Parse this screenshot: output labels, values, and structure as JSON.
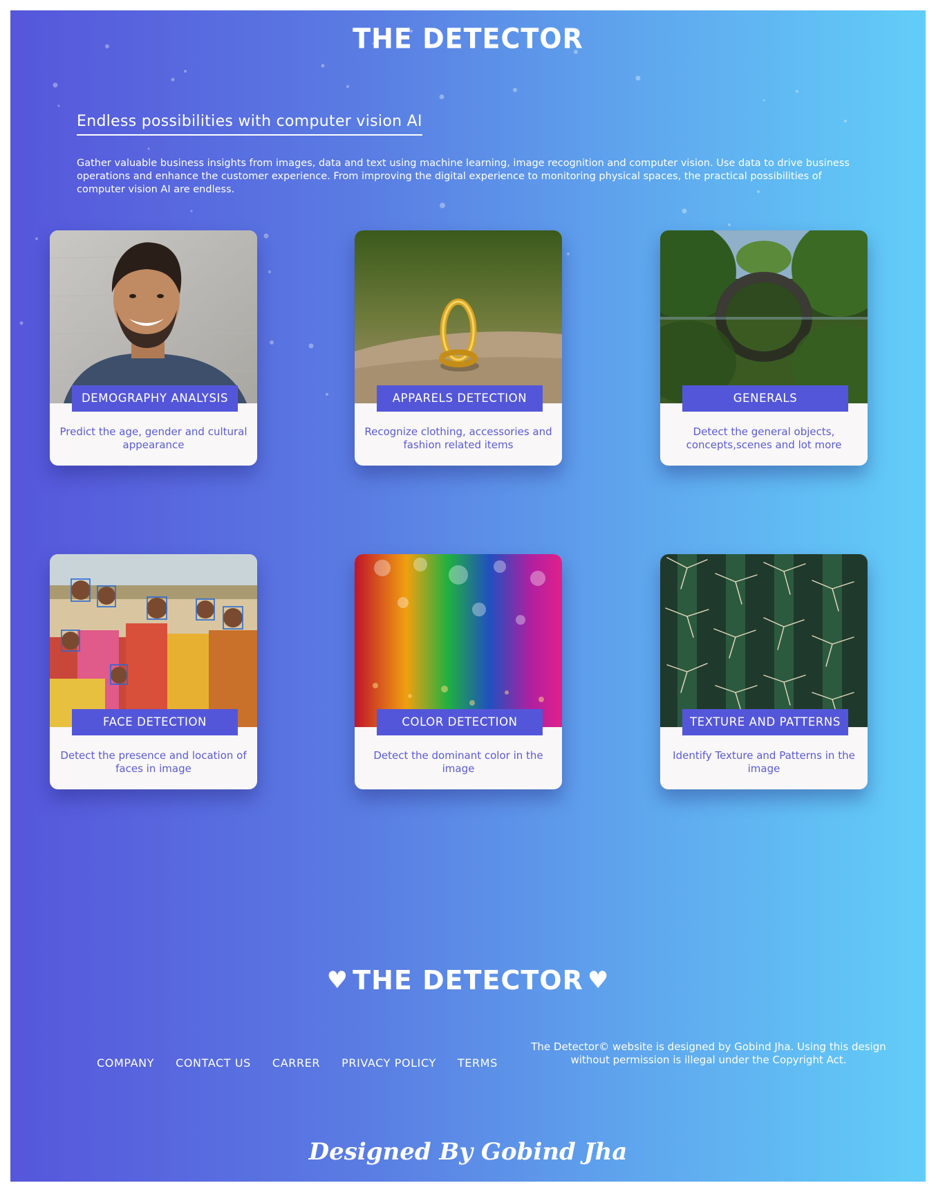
{
  "header": {
    "logo": "THE DETECTOR"
  },
  "hero": {
    "headline": "Endless possibilities with computer vision AI",
    "intro": "Gather valuable business insights from images, data and text using machine learning, image recognition and computer vision. Use data to drive business operations and enhance the customer experience. From improving the digital experience to monitoring physical spaces, the practical possibilities of computer vision AI are endless."
  },
  "cards": [
    {
      "title": "DEMOGRAPHY ANALYSIS",
      "description": "Predict the age, gender and cultural appearance",
      "image": "smiling-man-photo"
    },
    {
      "title": "APPARELS DETECTION",
      "description": "Recognize clothing, accessories and fashion related items",
      "image": "gold-ring-photo"
    },
    {
      "title": "GENERALS",
      "description": "Detect the general objects, concepts,scenes and lot more",
      "image": "stone-bridge-lake-photo"
    },
    {
      "title": "FACE DETECTION",
      "description": "Detect the presence and location of faces in image",
      "image": "group-faces-photo"
    },
    {
      "title": "COLOR DETECTION",
      "description": "Detect the dominant color in the image",
      "image": "rainbow-glitter-photo"
    },
    {
      "title": "TEXTURE AND PATTERNS",
      "description": "Identify Texture and Patterns in the image",
      "image": "cactus-spines-photo"
    }
  ],
  "footer": {
    "logo": "THE DETECTOR",
    "heart": "♥",
    "nav": [
      "COMPANY",
      "CONTACT US",
      "CARRER",
      "PRIVACY POLICY",
      "TERMS"
    ],
    "copyright": "The Detector© website is designed by Gobind Jha. Using this design without permission is illegal under the Copyright Act.",
    "signature": "Designed By Gobind Jha"
  },
  "colors": {
    "gradient_start": "#5656db",
    "gradient_end": "#62cdf8",
    "card_title_bg": "#5456da",
    "card_desc_text": "#5a5ad8",
    "card_bg": "#f9f7f7"
  }
}
